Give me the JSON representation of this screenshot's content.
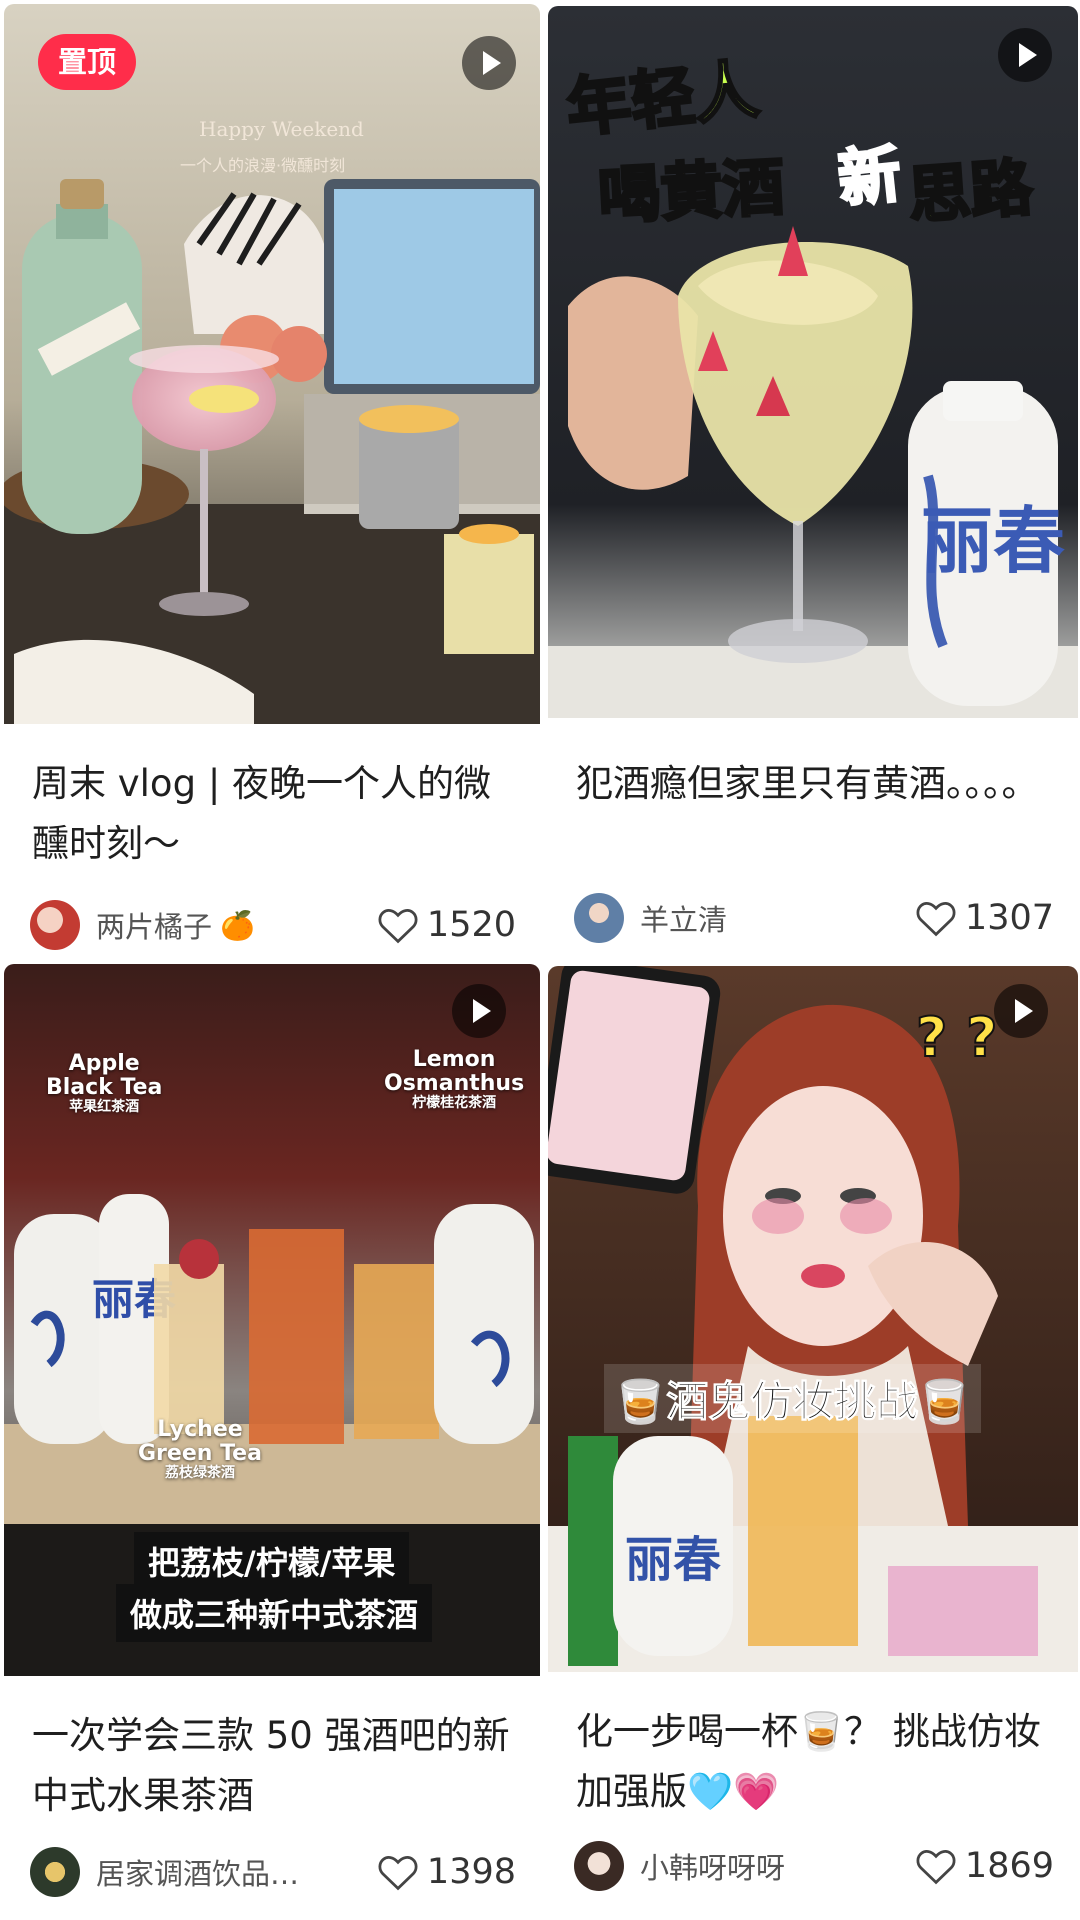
{
  "cards": [
    {
      "pinned_label": "置顶",
      "overlay_title": "Happy Weekend",
      "overlay_subtitle": "一个人的浪漫·微醺时刻",
      "title": "周末 vlog | 夜晚一个人的微醺时刻～",
      "author": "两片橘子",
      "author_emoji": "🍊",
      "likes": "1520"
    },
    {
      "overlay_line1": "年轻人",
      "overlay_line2a": "喝黄酒",
      "overlay_line2b": "新",
      "overlay_line2c": "思路",
      "bottle_text": "丽春",
      "title": "犯酒瘾但家里只有黄酒。。。。",
      "author": "羊立清",
      "likes": "1307"
    },
    {
      "label_apple_en1": "Apple",
      "label_apple_en2": "Black Tea",
      "label_apple_zh": "苹果红茶酒",
      "label_lemon_en1": "Lemon",
      "label_lemon_en2": "Osmanthus",
      "label_lemon_zh": "柠檬桂花茶酒",
      "label_lychee_en1": "Lychee",
      "label_lychee_en2": "Green Tea",
      "label_lychee_zh": "荔枝绿茶酒",
      "caption_line1": "把荔枝/柠檬/苹果",
      "caption_line2": "做成三种新中式茶酒",
      "bottle_text": "丽春",
      "title": "一次学会三款 50 强酒吧的新中式水果茶酒",
      "author": "居家调酒饮品…",
      "likes": "1398"
    },
    {
      "question_marks": "? ?",
      "challenge_text": "🥃酒鬼仿妆挑战🥃",
      "bottle_text": "丽春",
      "title": "化一步喝一杯🥃？ 挑战仿妆加强版🩵💗",
      "author": "小韩呀呀呀",
      "likes": "1869"
    }
  ],
  "colors": {
    "pin_bg": "#ff2d4a",
    "title_text": "#1f1f1f",
    "meta_text": "#555555"
  },
  "icons": {
    "play": "play-icon",
    "like": "heart-outline-icon"
  }
}
